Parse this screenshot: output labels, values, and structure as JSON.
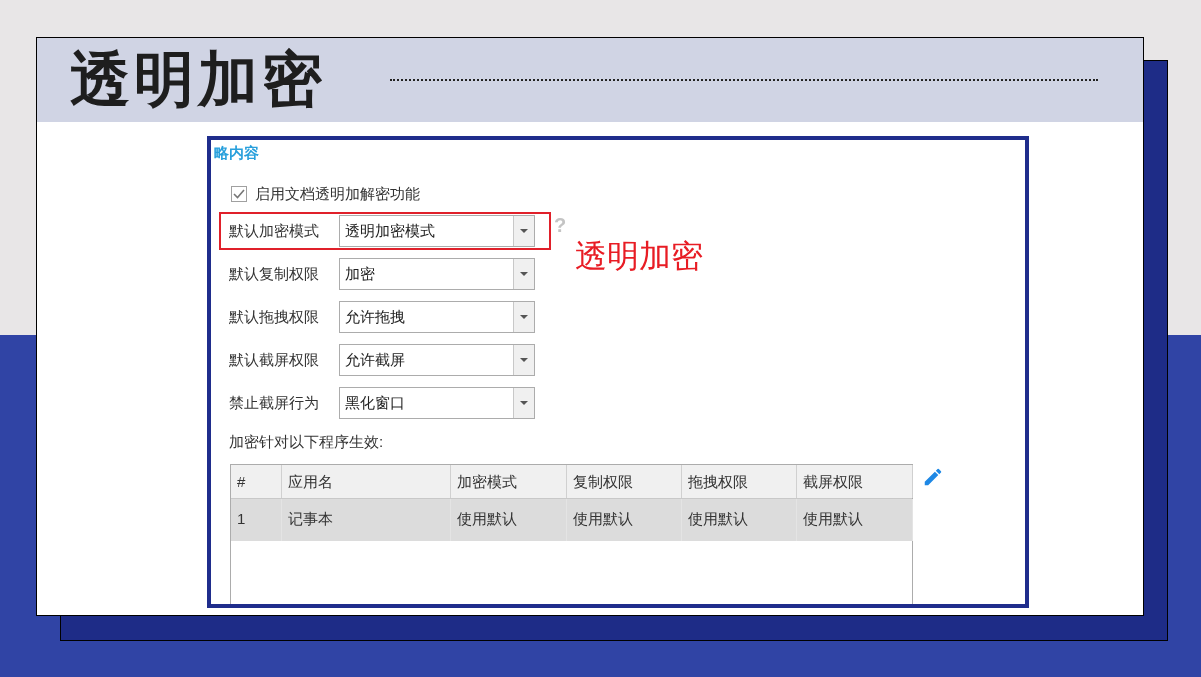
{
  "slide": {
    "title": "透明加密"
  },
  "screen": {
    "section_title": "略内容",
    "enable_option": {
      "label": "启用文档透明加解密功能",
      "checked": true
    },
    "settings": [
      {
        "label": "默认加密模式",
        "value": "透明加密模式",
        "highlighted": true,
        "help": "?"
      },
      {
        "label": "默认复制权限",
        "value": "加密",
        "highlighted": false
      },
      {
        "label": "默认拖拽权限",
        "value": "允许拖拽",
        "highlighted": false
      },
      {
        "label": "默认截屏权限",
        "value": "允许截屏",
        "highlighted": false
      },
      {
        "label": "禁止截屏行为",
        "value": "黑化窗口",
        "highlighted": false
      }
    ],
    "program_label": "加密针对以下程序生效:",
    "table": {
      "columns": [
        "#",
        "应用名",
        "加密模式",
        "复制权限",
        "拖拽权限",
        "截屏权限"
      ],
      "rows": [
        {
          "cells": [
            "1",
            "记事本",
            "使用默认",
            "使用默认",
            "使用默认",
            "使用默认"
          ],
          "selected": true
        }
      ]
    },
    "annotation": "透明加密"
  }
}
